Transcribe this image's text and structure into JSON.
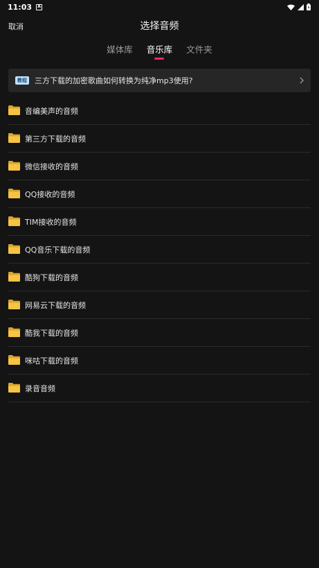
{
  "status_bar": {
    "time": "11:03",
    "notification_icon": "A",
    "icons": [
      "wifi-icon",
      "signal-icon",
      "battery-icon"
    ]
  },
  "header": {
    "cancel_label": "取消",
    "title": "选择音频"
  },
  "tabs": [
    {
      "label": "媒体库",
      "active": false
    },
    {
      "label": "音乐库",
      "active": true
    },
    {
      "label": "文件夹",
      "active": false
    }
  ],
  "banner": {
    "badge": "教程",
    "text": "三方下载的加密歌曲如何转换为纯净mp3使用?",
    "icon": "chevron-right-icon"
  },
  "folders": [
    {
      "label": "音编美声的音频"
    },
    {
      "label": "第三方下载的音频"
    },
    {
      "label": "微信接收的音频"
    },
    {
      "label": "QQ接收的音频"
    },
    {
      "label": "TIM接收的音频"
    },
    {
      "label": "QQ音乐下载的音频"
    },
    {
      "label": "酷狗下载的音频"
    },
    {
      "label": "网易云下载的音频"
    },
    {
      "label": "酷我下载的音频"
    },
    {
      "label": "咪咕下载的音频"
    },
    {
      "label": "录音音频"
    }
  ],
  "colors": {
    "background": "#141414",
    "accent": "#e4305b",
    "folder": "#f6c343"
  }
}
